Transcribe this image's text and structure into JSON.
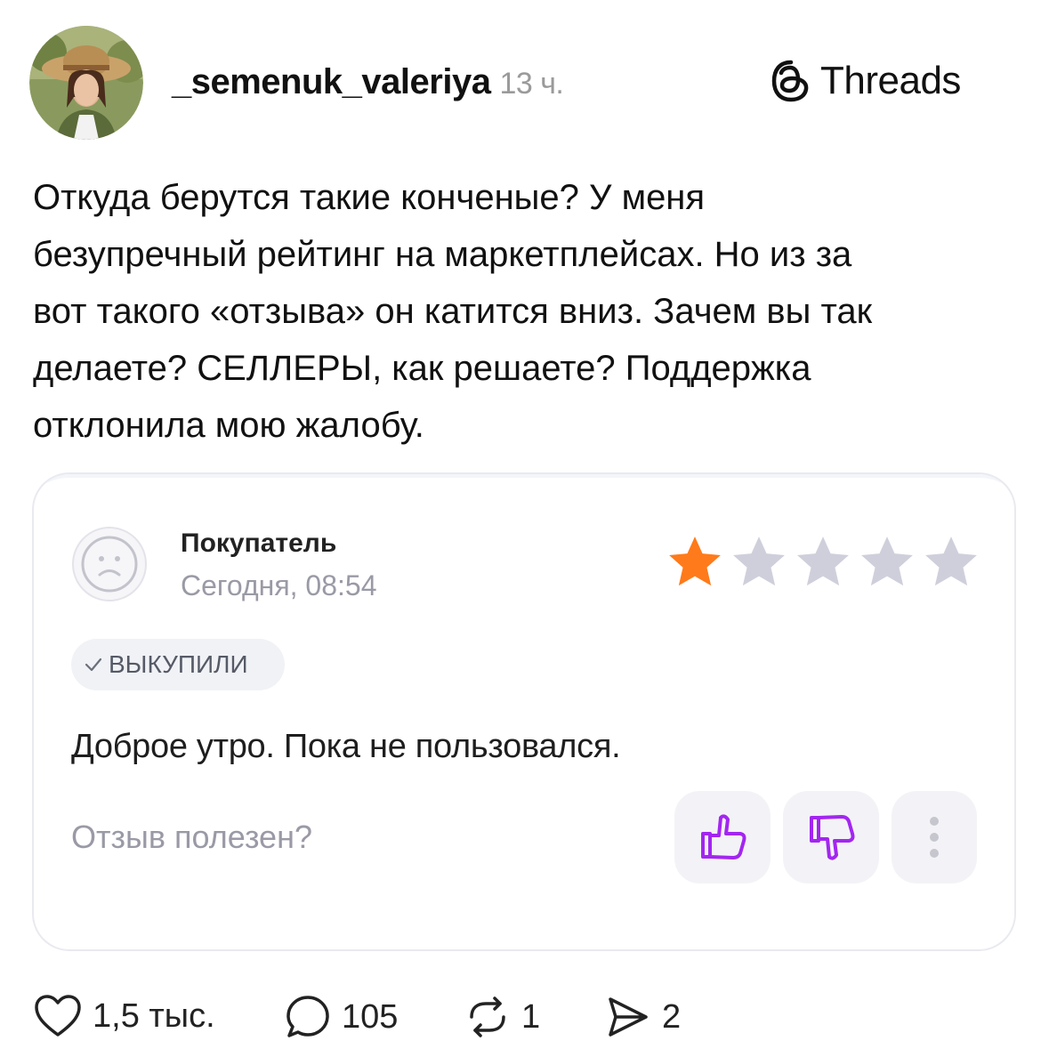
{
  "post": {
    "username": "_semenuk_valeriya",
    "time_ago": "13 ч.",
    "brand": "Threads",
    "text": "Откуда берутся такие конченые? У меня\nбезупречный рейтинг на маркетплейсах. Но из за\nвот такого «отзыва» он катится вниз. Зачем вы так\nделаете? СЕЛЛЕРЫ, как решаете? Поддержка\nотклонила мою жалобу."
  },
  "review": {
    "author": "Покупатель",
    "time": "Сегодня, 08:54",
    "rating": 1,
    "max_rating": 5,
    "badge": "ВЫКУПИЛИ",
    "text": "Доброе утро. Пока не пользовался.",
    "helpful_prompt": "Отзыв полезен?"
  },
  "stats": {
    "likes": "1,5 тыс.",
    "replies": "105",
    "reposts": "1",
    "shares": "2"
  },
  "colors": {
    "star_active": "#ff7a1a",
    "star_inactive": "#cfcfdc",
    "vote_icon": "#a326f0"
  }
}
